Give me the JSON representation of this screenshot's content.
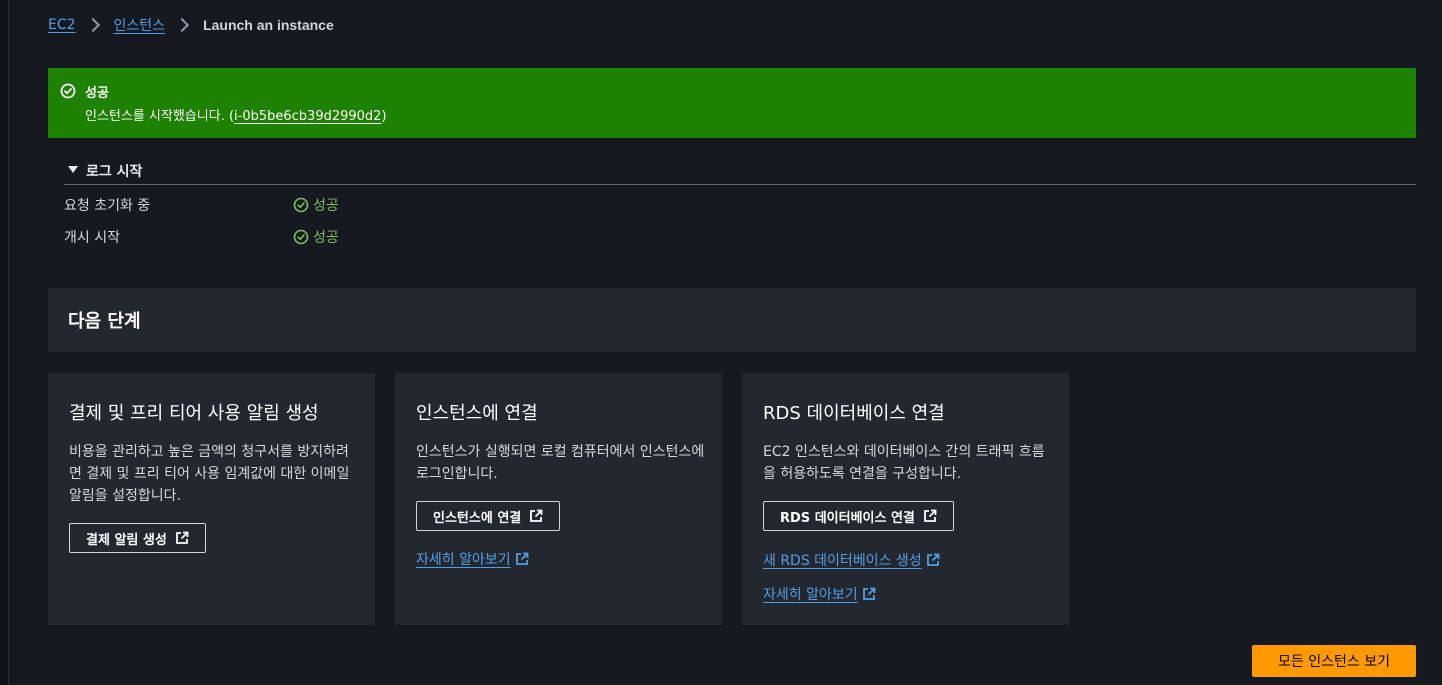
{
  "breadcrumb": {
    "items": [
      "EC2",
      "인스턴스"
    ],
    "current": "Launch an instance"
  },
  "flash": {
    "title": "성공",
    "message": "인스턴스를 시작했습니다. (",
    "instance_id": "i-0b5be6cb39d2990d2",
    "message_end": ")",
    "color": "#1d8102"
  },
  "log": {
    "title": "로그 시작",
    "rows": [
      {
        "label": "요청 초기화 중",
        "status": "성공"
      },
      {
        "label": "개시 시작",
        "status": "성공"
      }
    ]
  },
  "next_steps": {
    "title": "다음 단계",
    "cards": [
      {
        "title": "결제 및 프리 티어 사용 알림 생성",
        "description": "비용을 관리하고 높은 금액의 청구서를 방지하려면 결제 및 프리 티어 사용 임계값에 대한 이메일 알림을 설정합니다.",
        "button": "결제 알림 생성"
      },
      {
        "title": "인스턴스에 연결",
        "description": "인스턴스가 실행되면 로컬 컴퓨터에서 인스턴스에 로그인합니다.",
        "button": "인스턴스에 연결",
        "links": [
          "자세히 알아보기"
        ]
      },
      {
        "title": "RDS 데이터베이스 연결",
        "description": "EC2 인스턴스와 데이터베이스 간의 트래픽 흐름을 허용하도록 연결을 구성합니다.",
        "button": "RDS 데이터베이스 연결",
        "links": [
          "새 RDS 데이터베이스 생성",
          "자세히 알아보기"
        ]
      }
    ]
  },
  "footer": {
    "primary_button": "모든 인스턴스 보기",
    "accent": "#ff9900"
  },
  "icons": {
    "success": "check-circle-icon",
    "external": "external-link-icon",
    "caret": "caret-down-icon",
    "chevron": "chevron-right-icon"
  }
}
